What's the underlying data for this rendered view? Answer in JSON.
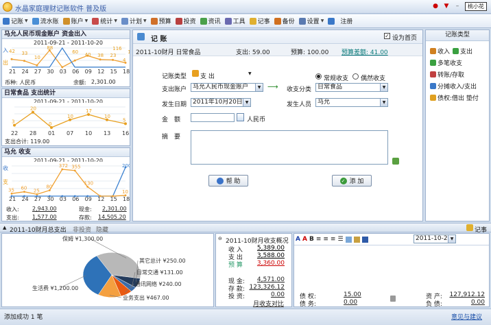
{
  "app": {
    "title": "水晶家庭理财记账软件 普及版",
    "user": "桃小花"
  },
  "toolbar": [
    {
      "label": "记账",
      "icon": "pencil-icon",
      "color": "#3b78c9",
      "dd": true
    },
    {
      "label": "流水账",
      "icon": "list-icon",
      "color": "#4a8fd6"
    },
    {
      "label": "账户",
      "icon": "account-icon",
      "color": "#d0902a",
      "dd": true
    },
    {
      "label": "统计",
      "icon": "bar-chart-icon",
      "color": "#c84a4a",
      "dd": true
    },
    {
      "label": "计划",
      "icon": "plan-icon",
      "color": "#6a8ec8",
      "dd": true
    },
    {
      "label": "预算",
      "icon": "budget-icon",
      "color": "#d0702a"
    },
    {
      "label": "投资",
      "icon": "invest-icon",
      "color": "#b84040"
    },
    {
      "label": "资讯",
      "icon": "info-icon",
      "color": "#4aa04a"
    },
    {
      "label": "工具",
      "icon": "tool-icon",
      "color": "#6a6ab0"
    },
    {
      "label": "记事",
      "icon": "note-icon",
      "color": "#e0b030"
    },
    {
      "label": "备份",
      "icon": "backup-icon",
      "color": "#d07020"
    },
    {
      "label": "设置",
      "icon": "settings-icon",
      "color": "#5a7ab0",
      "dd": true
    },
    {
      "label": "",
      "icon": "help-icon",
      "color": "#3a78c8"
    },
    {
      "label": "注册",
      "icon": "",
      "color": ""
    }
  ],
  "left": {
    "p1": {
      "title": "马允人民币现金账户 资金出入",
      "range": "2011-09-21 - 2011-10-20",
      "yl1": "入",
      "yl2": "出",
      "currency_label": "币种: 人民币",
      "balance_label": "余额:",
      "balance": "2,301.00"
    },
    "p2": {
      "title": "日常食品 支出统计",
      "range": "2011-09-21 - 2011-10-20",
      "total_label": "支出合计: 119.00"
    },
    "p3": {
      "title": "马允 收支",
      "range": "2011-09-21 - 2011-10-20",
      "yl1": "收",
      "yl2": "支",
      "income_label": "收入:",
      "income": "2,943.00",
      "cash_label": "现金:",
      "cash": "2,301.00",
      "expense_label": "支出:",
      "expense": "1,577.00",
      "deposit_label": "存款:",
      "deposit": "14,505.20"
    }
  },
  "entry": {
    "title": "记 账",
    "set_home": "设为首页",
    "period": "2011-10财月 日常食品",
    "spent": "支出: 59.00",
    "budget": "预算: 100.00",
    "diff": "预算差额: 41.00",
    "type_label": "记账类型",
    "type_value": "支 出",
    "account_label": "支出账户",
    "account": "马允人民币现金账户",
    "category_label": "收支分类",
    "category": "日常食品",
    "radio1": "常规收支",
    "radio2": "偶然收支",
    "date_label": "发生日期",
    "date": "2011年10月20日",
    "person_label": "发生人员",
    "person": "马允",
    "amount_label": "金　额",
    "amount": "",
    "currency": "人民币",
    "note_label": "摘　要",
    "note": "",
    "help": "帮 助",
    "add": "添 加"
  },
  "types": {
    "title": "记账类型",
    "items": [
      [
        "收入",
        "支出"
      ],
      [
        "多笔收支"
      ],
      [
        "转账/存取"
      ],
      [
        "分摊收入/支出"
      ],
      [
        "债权:借出 垫付"
      ]
    ]
  },
  "bottom": {
    "tabs": [
      "2011-10财月总支出",
      "非投资",
      "隐藏"
    ],
    "pie_slices": [
      {
        "label": "保姆 ¥1,300.00",
        "value": 1300,
        "color": "#b8b8b8"
      },
      {
        "label": "其它总计 ¥250.00",
        "value": 250,
        "color": "#233b5c"
      },
      {
        "label": "日常交通 ¥131.00",
        "value": 131,
        "color": "#3b6ca8"
      },
      {
        "label": "通讯网络 ¥240.00",
        "value": 240,
        "color": "#e95a12"
      },
      {
        "label": "业务支出 ¥467.00",
        "value": 467,
        "color": "#f4a040"
      },
      {
        "label": "生活费 ¥1,200.00",
        "value": 1200,
        "color": "#2e72b8"
      }
    ],
    "summary": {
      "title": "2011-10财月收支概况",
      "rows": [
        [
          "收 入",
          "5,389.00",
          "#000"
        ],
        [
          "支 出",
          "3,588.00",
          "#000"
        ],
        [
          "预 算",
          "3,360.00",
          "#c00"
        ]
      ],
      "rows2": [
        [
          "现 金:",
          "4,571.00"
        ],
        [
          "存 款:",
          "123,326.12"
        ],
        [
          "投 资:",
          "0.00"
        ]
      ],
      "link": "月收支对比"
    },
    "notes": {
      "title": "记事",
      "date": "2011-10-20"
    },
    "assets": {
      "rows": [
        [
          "债 权:",
          "15.00"
        ],
        [
          "债 务:",
          "0.00"
        ]
      ],
      "rows2": [
        [
          "资 产:",
          "127,912.12"
        ],
        [
          "负 债:",
          "0.00"
        ]
      ]
    }
  },
  "status": {
    "text": "添加成功 1 笔",
    "link": "意见与建议"
  },
  "chart_data": [
    {
      "type": "line",
      "title": "马允人民币现金账户 资金出入",
      "x": [
        "21",
        "24",
        "27",
        "30",
        "03",
        "06",
        "09",
        "12",
        "15",
        "18"
      ],
      "income": [
        0,
        0,
        0,
        0,
        500,
        0,
        0,
        0,
        0,
        0
      ],
      "expense": [
        42,
        33,
        10,
        88,
        0,
        35,
        60,
        40,
        38,
        23
      ],
      "labels_top": [
        "42",
        "33",
        "10",
        "88",
        "60",
        "40",
        "38",
        "23",
        "4",
        "16",
        "116"
      ]
    },
    {
      "type": "line",
      "title": "日常食品 支出统计",
      "x": [
        "22",
        "28",
        "01",
        "07",
        "10",
        "13",
        "16"
      ],
      "values": [
        3,
        20,
        0,
        10,
        17,
        10,
        5
      ],
      "ticks": [
        "22",
        "28",
        "01",
        "07",
        "10",
        "13",
        "16"
      ]
    },
    {
      "type": "line",
      "title": "马允 收支",
      "x": [
        "21",
        "24",
        "27",
        "30",
        "03",
        "06",
        "09",
        "12",
        "15",
        "18"
      ],
      "series": [
        {
          "name": "收",
          "values": [
            0,
            0,
            0,
            0,
            0,
            0,
            0,
            0,
            0,
            2000
          ]
        },
        {
          "name": "支",
          "values": [
            35,
            60,
            25,
            80,
            372,
            355,
            130,
            0,
            0,
            10
          ]
        }
      ]
    }
  ]
}
